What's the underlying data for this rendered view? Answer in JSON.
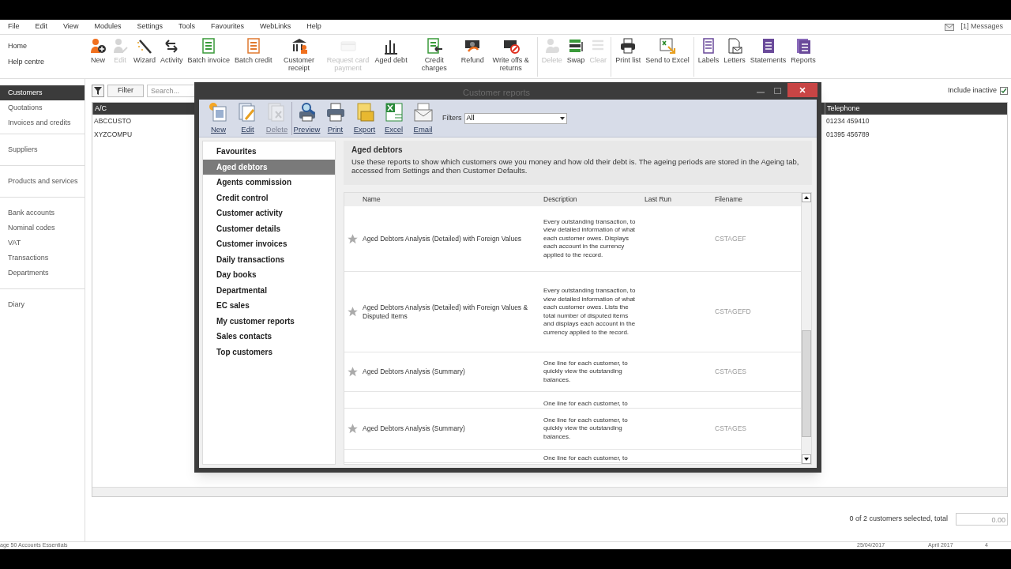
{
  "menu_bar": {
    "items": [
      "File",
      "Edit",
      "View",
      "Modules",
      "Settings",
      "Tools",
      "Favourites",
      "WebLinks",
      "Help"
    ],
    "messages": "[1] Messages"
  },
  "quick_links": [
    "Home",
    "Help centre"
  ],
  "toolbar": {
    "groups": [
      [
        {
          "label": "New",
          "disabled": false
        },
        {
          "label": "Edit",
          "disabled": true
        },
        {
          "label": "Wizard",
          "disabled": false
        },
        {
          "label": "Activity",
          "disabled": false
        },
        {
          "label": "Batch invoice",
          "disabled": false
        },
        {
          "label": "Batch credit",
          "disabled": false
        },
        {
          "label": "Customer receipt",
          "disabled": false
        },
        {
          "label": "Request card payment",
          "disabled": true
        },
        {
          "label": "Aged debt",
          "disabled": false
        },
        {
          "label": "Credit charges",
          "disabled": false
        },
        {
          "label": "Refund",
          "disabled": false
        },
        {
          "label": "Write offs & returns",
          "disabled": false
        }
      ],
      [
        {
          "label": "Delete",
          "disabled": true
        },
        {
          "label": "Swap",
          "disabled": false
        },
        {
          "label": "Clear",
          "disabled": true
        }
      ],
      [
        {
          "label": "Print list",
          "disabled": false
        },
        {
          "label": "Send to Excel",
          "disabled": false
        }
      ],
      [
        {
          "label": "Labels",
          "disabled": false
        },
        {
          "label": "Letters",
          "disabled": false
        },
        {
          "label": "Statements",
          "disabled": false
        },
        {
          "label": "Reports",
          "disabled": false
        }
      ]
    ]
  },
  "navigation": {
    "sections": [
      [
        {
          "label": "Customers",
          "selected": true
        },
        {
          "label": "Quotations",
          "selected": false
        },
        {
          "label": "Invoices and credits",
          "selected": false
        }
      ],
      [
        {
          "label": "Suppliers",
          "selected": false
        }
      ],
      [
        {
          "label": "Products and services",
          "selected": false
        }
      ],
      [
        {
          "label": "Bank accounts",
          "selected": false
        },
        {
          "label": "Nominal codes",
          "selected": false
        },
        {
          "label": "VAT",
          "selected": false
        },
        {
          "label": "Transactions",
          "selected": false
        },
        {
          "label": "Departments",
          "selected": false
        }
      ],
      [
        {
          "label": "Diary",
          "selected": false
        }
      ]
    ]
  },
  "list_view": {
    "filter_button": "Filter",
    "search": {
      "placeholder": "Search..."
    },
    "include_inactive": {
      "label": "Include inactive",
      "checked": true
    },
    "columns": [
      "A/C",
      "Telephone"
    ],
    "rows": [
      [
        "ABCCUSTO",
        "01234 459410"
      ],
      [
        "XYZCOMPU",
        "01395 456789"
      ]
    ],
    "selection_summary": "0 of 2 customers selected, total",
    "total": "0.00"
  },
  "reports_dialog": {
    "title": "Customer reports",
    "toolbar": [
      {
        "label": "New",
        "disabled": false
      },
      {
        "label": "Edit",
        "disabled": false
      },
      {
        "label": "Delete",
        "disabled": true
      },
      {
        "label": "Preview",
        "disabled": false
      },
      {
        "label": "Print",
        "disabled": false
      },
      {
        "label": "Export",
        "disabled": false
      },
      {
        "label": "Excel",
        "disabled": false
      },
      {
        "label": "Email",
        "disabled": false
      }
    ],
    "filters": {
      "label": "Filters",
      "value": "All"
    },
    "categories": [
      {
        "label": "Favourites",
        "selected": false
      },
      {
        "label": "Aged debtors",
        "selected": true
      },
      {
        "label": "Agents commission",
        "selected": false
      },
      {
        "label": "Credit control",
        "selected": false
      },
      {
        "label": "Customer activity",
        "selected": false
      },
      {
        "label": "Customer details",
        "selected": false
      },
      {
        "label": "Customer invoices",
        "selected": false
      },
      {
        "label": "Daily transactions",
        "selected": false
      },
      {
        "label": "Day books",
        "selected": false
      },
      {
        "label": "Departmental",
        "selected": false
      },
      {
        "label": "EC sales",
        "selected": false
      },
      {
        "label": "My customer reports",
        "selected": false
      },
      {
        "label": "Sales contacts",
        "selected": false
      },
      {
        "label": "Top customers",
        "selected": false
      }
    ],
    "heading": "Aged debtors",
    "description": "Use these reports to show which customers owe you money and how old their debt is. The ageing periods are stored in the Ageing tab, accessed from Settings and then Customer Defaults.",
    "columns": [
      "Name",
      "Description",
      "Last Run",
      "Filename"
    ],
    "rows": [
      {
        "kind": "full",
        "name": "Aged Debtors Analysis (Detailed) with Foreign Values",
        "description": "Every outstanding transaction, to view detailed information of what each customer owes. Displays each account in the currency applied to the record.",
        "filename": "CSTAGEF"
      },
      {
        "kind": "full",
        "name": "Aged Debtors Analysis (Detailed) with Foreign Values & Disputed Items",
        "description": "Every outstanding transaction, to view detailed information of what each customer owes. Lists the total number of disputed items and displays each account in the currency applied to the record.",
        "filename": "CSTAGEFD"
      },
      {
        "kind": "full",
        "name": "Aged Debtors Analysis (Summary)",
        "description": "One line for each customer, to quickly view the outstanding balances.",
        "filename": "CSTAGES"
      },
      {
        "kind": "partial",
        "description": "One line for each customer, to"
      },
      {
        "kind": "full",
        "name": "Aged Debtors Analysis (Summary)",
        "description": "One line for each customer, to quickly view the outstanding balances.",
        "filename": "CSTAGES"
      },
      {
        "kind": "partial",
        "description": "One line for each customer, to"
      }
    ]
  },
  "status_bar": [
    "age 50 Accounts Essentials",
    "25/04/2017",
    "April 2017",
    "4"
  ]
}
